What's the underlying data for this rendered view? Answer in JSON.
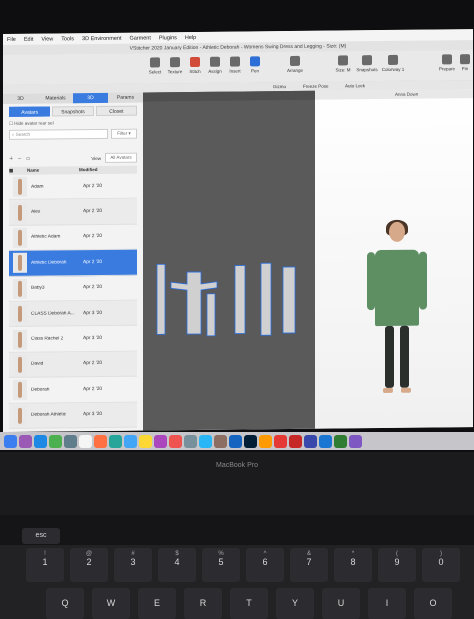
{
  "menu": [
    "File",
    "Edit",
    "View",
    "Tools",
    "3D Environment",
    "Garment",
    "Plugins",
    "Help"
  ],
  "window_title": "VStitcher 2020 January Edition - Athletic Deborah - Womens Swing Dress and Legging - Size: (M)",
  "toolbar": {
    "tools": [
      "Select",
      "Texture",
      "Stitch",
      "Assign",
      "Insert",
      "Pen"
    ],
    "right_tools": [
      "Arrange",
      "Size: M",
      "Snapshots",
      "Colorway 1",
      "Prepare",
      "Fin"
    ]
  },
  "subbar": {
    "items": [
      "Gizmo",
      "Freeze Pose",
      "Auto Lock"
    ],
    "avatar_name": "Anna Down"
  },
  "left_panel": {
    "tabs": [
      "3D",
      "Materials",
      "3D",
      "Params"
    ],
    "subtabs": [
      "Avatars",
      "Snapshots",
      "Closet"
    ],
    "checkbox_label": "Hide avatar rear sel",
    "search_placeholder": "Search",
    "filter_label": "Filter",
    "view_label": "View",
    "view_select": "All Avatars",
    "columns": [
      "Name",
      "Modified"
    ],
    "rows": [
      {
        "name": "Adam",
        "date": "Apr 2 '20"
      },
      {
        "name": "Alex",
        "date": "Apr 2 '20"
      },
      {
        "name": "Athletic Adam",
        "date": "Apr 2 '20"
      },
      {
        "name": "Athletic Deborah",
        "date": "Apr 2 '20"
      },
      {
        "name": "Baby3",
        "date": "Apr 2 '20"
      },
      {
        "name": "CLASS Deborah A...",
        "date": "Apr 3 '20"
      },
      {
        "name": "Class Rachel 2",
        "date": "Apr 3 '20"
      },
      {
        "name": "David",
        "date": "Apr 2 '20"
      },
      {
        "name": "Deborah",
        "date": "Apr 2 '20"
      },
      {
        "name": "Deborah Athletic",
        "date": "Apr 3 '20"
      }
    ],
    "selected_index": 3
  },
  "brand": "MacBook Pro",
  "keyboard": {
    "row_esc": "esc",
    "numbers": [
      {
        "top": "!",
        "main": "1"
      },
      {
        "top": "@",
        "main": "2"
      },
      {
        "top": "#",
        "main": "3"
      },
      {
        "top": "$",
        "main": "4"
      },
      {
        "top": "%",
        "main": "5"
      },
      {
        "top": "^",
        "main": "6"
      },
      {
        "top": "&",
        "main": "7"
      },
      {
        "top": "*",
        "main": "8"
      },
      {
        "top": "(",
        "main": "9"
      },
      {
        "top": ")",
        "main": "0"
      }
    ],
    "letters": [
      "Q",
      "W",
      "E",
      "R",
      "T",
      "Y",
      "U",
      "I",
      "O"
    ]
  },
  "colors": {
    "accent": "#3a7be0",
    "dress": "#5d8f63"
  }
}
